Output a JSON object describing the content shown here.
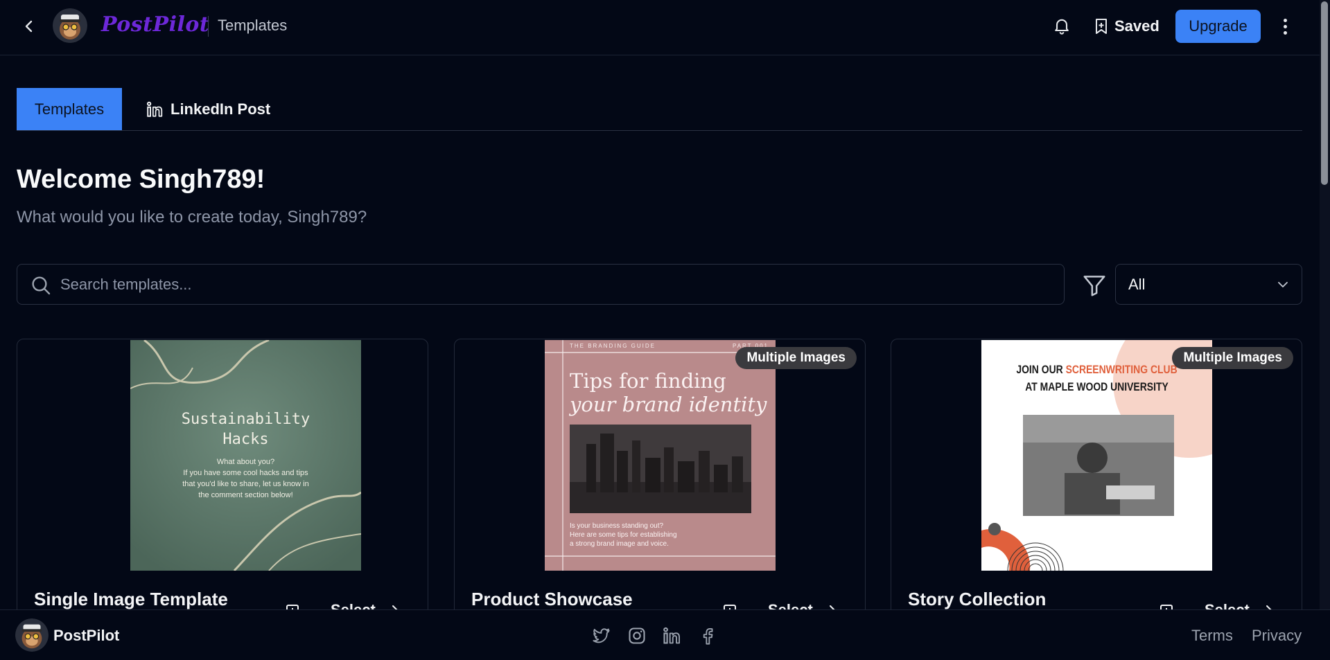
{
  "header": {
    "brand": "PostPilot",
    "breadcrumb": "Templates",
    "saved_label": "Saved",
    "upgrade_label": "Upgrade",
    "icons": [
      "back-chevron-icon",
      "bell-icon",
      "bookmark-icon",
      "more-vertical-icon"
    ]
  },
  "tabs": [
    {
      "label": "Templates",
      "active": true
    },
    {
      "label": "LinkedIn Post",
      "active": false,
      "icon": "linkedin-icon"
    }
  ],
  "welcome": {
    "title": "Welcome Singh789!",
    "subtitle": "What would you like to create today, Singh789?"
  },
  "search": {
    "placeholder": "Search templates...",
    "value": ""
  },
  "filter": {
    "selected": "All"
  },
  "cards": [
    {
      "title": "Single Image Template",
      "badge": "",
      "select_label": "Select",
      "preview": {
        "heading_line1": "Sustainability",
        "heading_line2": "Hacks",
        "body_line1": "What about you?",
        "body_line2": "If you have some cool hacks and tips",
        "body_line3": "that you'd like to share, let us know in",
        "body_line4": "the comment section below!"
      }
    },
    {
      "title": "Product Showcase",
      "badge": "Multiple Images",
      "select_label": "Select",
      "preview": {
        "top_left": "THE BRANDING GUIDE",
        "top_right": "PART 001",
        "heading_line1": "Tips for finding",
        "heading_line2": "your brand identity",
        "body_line1": "Is your business standing out?",
        "body_line2": "Here are some tips for establishing",
        "body_line3": "a strong brand image and voice."
      }
    },
    {
      "title": "Story Collection",
      "badge": "Multiple Images",
      "select_label": "Select",
      "preview": {
        "line1_a": "JOIN OUR ",
        "line1_b": "SCREENWRITING CLUB",
        "line2": "AT MAPLE WOOD UNIVERSITY"
      }
    }
  ],
  "footer": {
    "brand": "PostPilot",
    "social_icons": [
      "twitter-icon",
      "instagram-icon",
      "linkedin-icon",
      "facebook-icon"
    ],
    "terms_label": "Terms",
    "privacy_label": "Privacy"
  },
  "colors": {
    "background": "#030816",
    "accent": "#3b82f6",
    "brand": "#6d28d9",
    "accent_orange": "#e0603c"
  }
}
